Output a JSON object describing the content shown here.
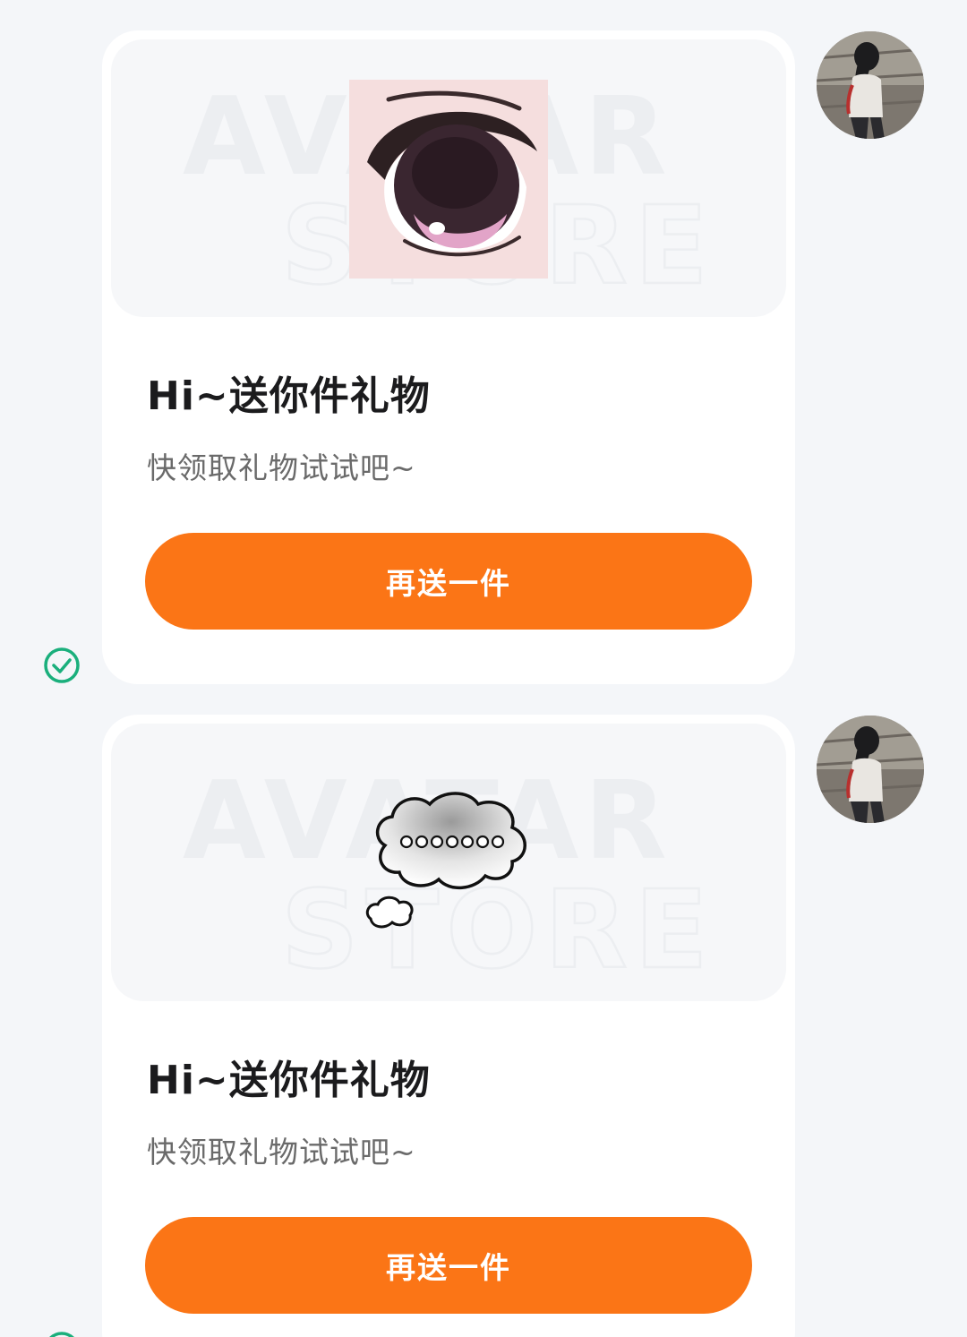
{
  "messages": [
    {
      "gift_icon": "anime-eye-icon",
      "watermark_line1": "AVATAR",
      "watermark_line2": "STORE",
      "title": "Hi~送你件礼物",
      "subtitle": "快领取礼物试试吧~",
      "button_label": "再送一件",
      "status_icon": "check-circle-icon"
    },
    {
      "gift_icon": "thought-bubble-icon",
      "watermark_line1": "AVATAR",
      "watermark_line2": "STORE",
      "title": "Hi~送你件礼物",
      "subtitle": "快领取礼物试试吧~",
      "button_label": "再送一件",
      "status_icon": "check-circle-icon"
    }
  ],
  "colors": {
    "accent": "#fb7516",
    "status_green": "#1aaf7c",
    "background": "#f4f6f9",
    "card": "#ffffff"
  }
}
